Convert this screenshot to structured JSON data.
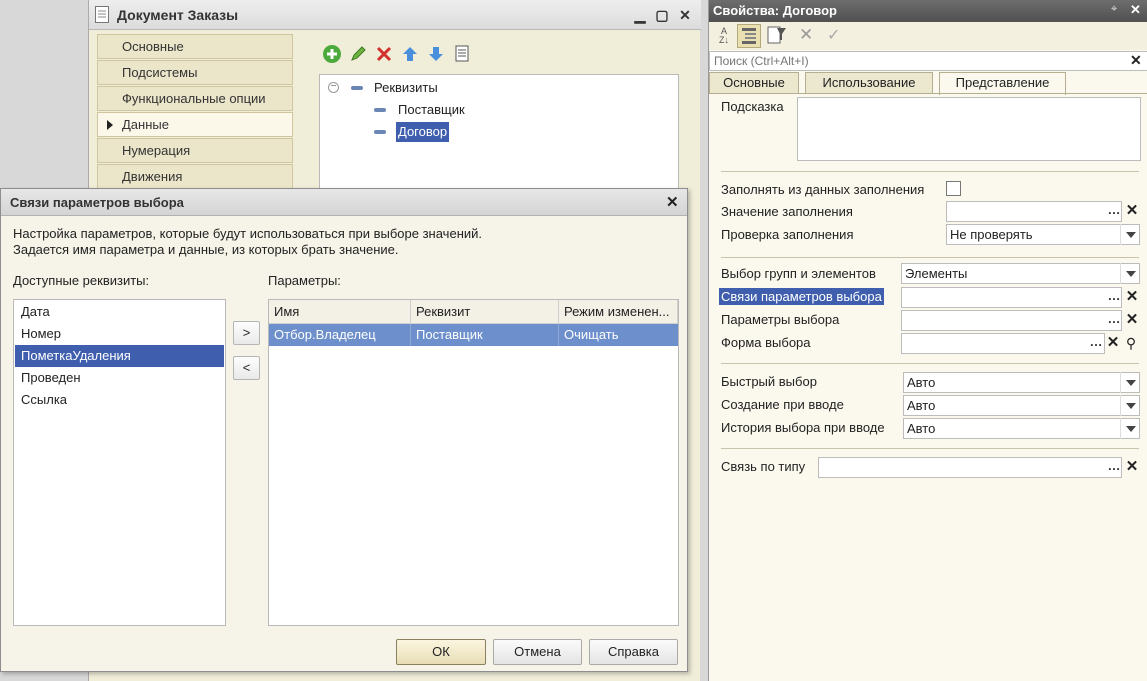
{
  "doc_window": {
    "title": "Документ Заказы",
    "nav_items": [
      "Основные",
      "Подсистемы",
      "Функциональные опции",
      "Данные",
      "Нумерация",
      "Движения"
    ],
    "selected_nav": "Данные",
    "tree": {
      "root": "Реквизиты",
      "children": [
        "Поставщик",
        "Договор"
      ],
      "selected": "Договор"
    }
  },
  "props_panel": {
    "title": "Свойства: Договор",
    "search_placeholder": "Поиск (Ctrl+Alt+I)",
    "tabs": [
      "Основные",
      "Использование",
      "Представление"
    ],
    "active_tab": "Представление",
    "hint_label": "Подсказка",
    "fill_from_data_label": "Заполнять из данных заполнения",
    "fill_value_label": "Значение заполнения",
    "fill_check_label": "Проверка заполнения",
    "fill_check_value": "Не проверять",
    "choice_groups_label": "Выбор групп и элементов",
    "choice_groups_value": "Элементы",
    "choice_links_label": "Связи параметров выбора",
    "choice_params_label": "Параметры выбора",
    "choice_form_label": "Форма выбора",
    "quick_choice_label": "Быстрый выбор",
    "quick_choice_value": "Авто",
    "create_on_input_label": "Создание при вводе",
    "create_on_input_value": "Авто",
    "choice_history_label": "История выбора при вводе",
    "choice_history_value": "Авто",
    "type_link_label": "Связь по типу"
  },
  "dialog": {
    "title": "Связи параметров выбора",
    "description_line1": "Настройка параметров, которые будут использоваться при выборе значений.",
    "description_line2": "Задается имя параметра и данные, из которых брать значение.",
    "available_label": "Доступные реквизиты:",
    "params_label": "Параметры:",
    "available_items": [
      "Дата",
      "Номер",
      "ПометкаУдаления",
      "Проведен",
      "Ссылка"
    ],
    "selected_available": "ПометкаУдаления",
    "add_button": ">",
    "remove_button": "<",
    "columns": [
      "Имя",
      "Реквизит",
      "Режим изменен..."
    ],
    "rows": [
      {
        "name": "Отбор.Владелец",
        "attribute": "Поставщик",
        "mode": "Очищать"
      }
    ],
    "ok_label": "ОК",
    "cancel_label": "Отмена",
    "help_label": "Справка"
  },
  "colors": {
    "selection": "#3f5fae",
    "table_row_selection": "#6d8fcb",
    "panel_bg": "#fbf9ee",
    "props_title_bg": "#505050"
  }
}
